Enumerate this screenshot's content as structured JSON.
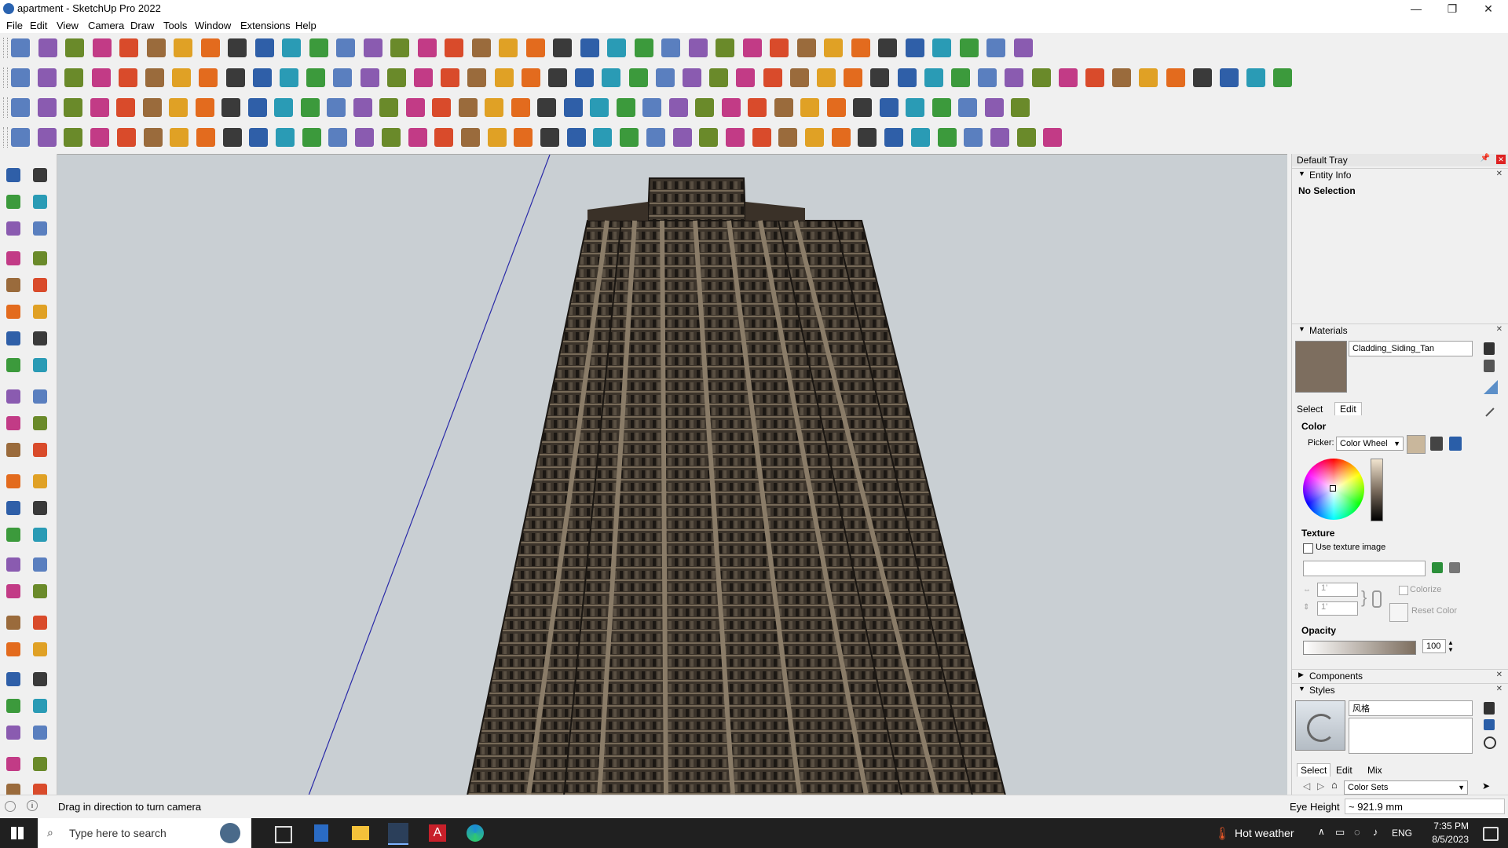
{
  "window": {
    "title": "apartment - SketchUp Pro 2022",
    "minimize": "—",
    "maximize": "❐",
    "close": "✕"
  },
  "menu": [
    "File",
    "Edit",
    "View",
    "Camera",
    "Draw",
    "Tools",
    "Window",
    "Extensions",
    "Help"
  ],
  "tray": {
    "title": "Default Tray",
    "entity_info": {
      "label": "Entity Info",
      "selection": "No Selection"
    },
    "materials": {
      "label": "Materials",
      "name": "Cladding_Siding_Tan",
      "swatch_color": "#7d6e5f",
      "tabs": [
        "Select",
        "Edit"
      ],
      "color_label": "Color",
      "picker_label": "Picker:",
      "picker_value": "Color Wheel",
      "texture_label": "Texture",
      "use_texture": "Use texture image",
      "width_value": "1'",
      "height_value": "1'",
      "colorize": "Colorize",
      "reset_color": "Reset Color",
      "opacity_label": "Opacity",
      "opacity_value": "100"
    },
    "components": {
      "label": "Components"
    },
    "styles": {
      "label": "Styles",
      "name": "风格",
      "tabs": [
        "Select",
        "Edit",
        "Mix"
      ],
      "collection": "Color Sets"
    }
  },
  "status": {
    "hint": "Drag in direction to turn camera",
    "measure_label": "Eye Height",
    "measure_value": "~ 921.9 mm"
  },
  "taskbar": {
    "search_placeholder": "Type here to search",
    "weather": "Hot weather",
    "language": "ENG",
    "time": "7:35 PM",
    "date": "8/5/2023"
  }
}
